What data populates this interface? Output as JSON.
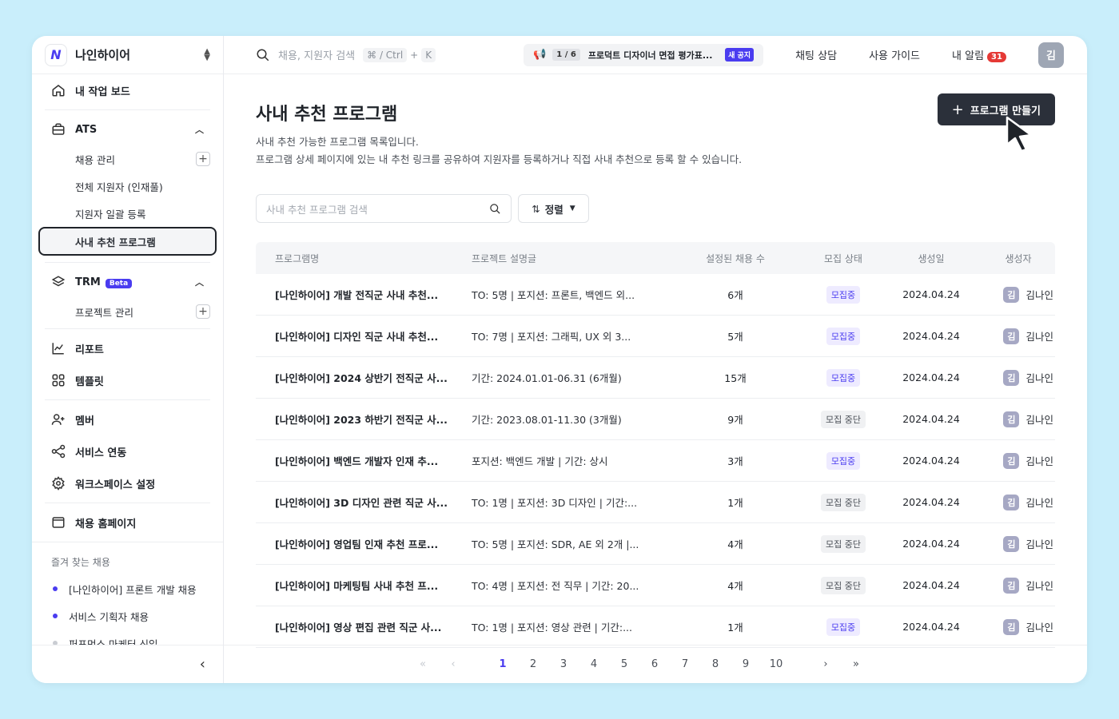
{
  "workspace": {
    "logo": "N",
    "name": "나인하이어"
  },
  "sidebar": {
    "dashboard": "내 작업 보드",
    "ats": {
      "label": "ATS",
      "items": [
        "채용 관리",
        "전체 지원자 (인재풀)",
        "지원자 일괄 등록",
        "사내 추천 프로그램"
      ]
    },
    "trm": {
      "label": "TRM",
      "beta": "Beta",
      "items": [
        "프로젝트 관리"
      ]
    },
    "report": "리포트",
    "template": "템플릿",
    "member": "멤버",
    "integration": "서비스 연동",
    "workspace_settings": "워크스페이스 설정",
    "career_page": "채용 홈페이지",
    "favorites_title": "즐겨 찾는 채용",
    "favorites": [
      "[나인하이어] 프론트 개발 채용",
      "서비스 기획자 채용",
      "퍼포먼스 마케터 신입"
    ]
  },
  "topbar": {
    "search_placeholder": "채용, 지원자 검색",
    "shortcut_a": "⌘ / Ctrl",
    "shortcut_plus": "+",
    "shortcut_b": "K",
    "notice_counter": "1 / 6",
    "notice_text": "프로덕트 디자이너 면접 평가표...",
    "notice_badge": "새 공지",
    "chat": "채팅 상담",
    "guide": "사용 가이드",
    "alarm": "내 알림",
    "alarm_count": "31",
    "avatar": "김"
  },
  "page": {
    "title": "사내 추천 프로그램",
    "desc1": "사내 추천 가능한 프로그램 목록입니다.",
    "desc2": "프로그램 상세 페이지에 있는 내 추천 링크를 공유하여 지원자를 등록하거나 직접 사내 추천으로 등록 할 수 있습니다.",
    "create_button": "프로그램 만들기",
    "search_placeholder": "사내 추천 프로그램 검색",
    "sort_label": "정렬"
  },
  "table": {
    "headers": [
      "프로그램명",
      "프로젝트 설명글",
      "설정된 채용 수",
      "모집 상태",
      "생성일",
      "생성자"
    ],
    "rows": [
      {
        "name": "[나인하이어] 개발 전직군 사내 추천...",
        "desc": "TO: 5명 | 포지션: 프론트, 백엔드 외...",
        "count": "6개",
        "status": "모집중",
        "status_type": "open",
        "date": "2024.04.24",
        "avatar": "김",
        "creator": "김나인"
      },
      {
        "name": "[나인하이어] 디자인 직군 사내 추천...",
        "desc": "TO: 7명 | 포지션: 그래픽, UX 외 3...",
        "count": "5개",
        "status": "모집중",
        "status_type": "open",
        "date": "2024.04.24",
        "avatar": "김",
        "creator": "김나인"
      },
      {
        "name": "[나인하이어] 2024 상반기 전직군 사...",
        "desc": "기간: 2024.01.01-06.31 (6개월)",
        "count": "15개",
        "status": "모집중",
        "status_type": "open",
        "date": "2024.04.24",
        "avatar": "김",
        "creator": "김나인"
      },
      {
        "name": "[나인하이어] 2023 하반기 전직군 사...",
        "desc": "기간: 2023.08.01-11.30 (3개월)",
        "count": "9개",
        "status": "모집 중단",
        "status_type": "stop",
        "date": "2024.04.24",
        "avatar": "김",
        "creator": "김나인"
      },
      {
        "name": "[나인하이어] 백엔드 개발자 인재 추...",
        "desc": "포지션: 백엔드 개발 | 기간: 상시",
        "count": "3개",
        "status": "모집중",
        "status_type": "open",
        "date": "2024.04.24",
        "avatar": "김",
        "creator": "김나인"
      },
      {
        "name": "[나인하이어] 3D 디자인 관련 직군 사...",
        "desc": "TO: 1명 | 포지션: 3D 디자인 | 기간:...",
        "count": "1개",
        "status": "모집 중단",
        "status_type": "stop",
        "date": "2024.04.24",
        "avatar": "김",
        "creator": "김나인"
      },
      {
        "name": "[나인하이어] 영업팀 인재 추천 프로...",
        "desc": "TO: 5명 | 포지션: SDR, AE 외 2개 |...",
        "count": "4개",
        "status": "모집 중단",
        "status_type": "stop",
        "date": "2024.04.24",
        "avatar": "김",
        "creator": "김나인"
      },
      {
        "name": "[나인하이어] 마케팅팀 사내 추천 프...",
        "desc": "TO: 4명 | 포지션: 전 직무 | 기간: 20...",
        "count": "4개",
        "status": "모집 중단",
        "status_type": "stop",
        "date": "2024.04.24",
        "avatar": "김",
        "creator": "김나인"
      },
      {
        "name": "[나인하이어] 영상 편집 관련 직군 사...",
        "desc": "TO: 1명 | 포지션: 영상 관련 | 기간:...",
        "count": "1개",
        "status": "모집중",
        "status_type": "open",
        "date": "2024.04.24",
        "avatar": "김",
        "creator": "김나인"
      }
    ]
  },
  "pagination": {
    "first": "«",
    "prev": "‹",
    "pages": [
      "1",
      "2",
      "3",
      "4",
      "5",
      "6",
      "7",
      "8",
      "9",
      "10"
    ],
    "current": "1",
    "next": "›",
    "last": "»"
  },
  "colors": {
    "accent": "#4a3cf0",
    "background": "#c9eefb",
    "button_dark": "#2b303a",
    "alarm": "#e53935"
  }
}
